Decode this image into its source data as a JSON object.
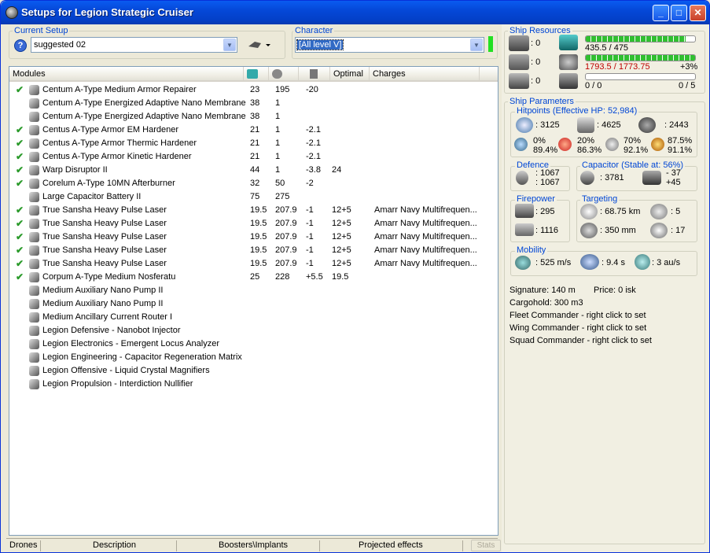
{
  "window": {
    "title": "Setups for Legion Strategic Cruiser"
  },
  "current_setup": {
    "label": "Current Setup",
    "value": "suggested 02"
  },
  "character": {
    "label": "Character",
    "value": "[All level V]"
  },
  "modules": {
    "headers": [
      "Modules",
      "",
      "",
      "",
      "Optimal",
      "Charges"
    ],
    "rows": [
      {
        "check": "✔",
        "name": "Centum A-Type Medium Armor Repairer",
        "c1": "23",
        "c2": "195",
        "c3": "-20",
        "c4": "",
        "c5": ""
      },
      {
        "check": "",
        "name": "Centum A-Type Energized Adaptive Nano Membrane",
        "c1": "38",
        "c2": "1",
        "c3": "",
        "c4": "",
        "c5": ""
      },
      {
        "check": "",
        "name": "Centum A-Type Energized Adaptive Nano Membrane",
        "c1": "38",
        "c2": "1",
        "c3": "",
        "c4": "",
        "c5": ""
      },
      {
        "check": "✔",
        "name": "Centus A-Type Armor EM Hardener",
        "c1": "21",
        "c2": "1",
        "c3": "-2.1",
        "c4": "",
        "c5": ""
      },
      {
        "check": "✔",
        "name": "Centus A-Type Armor Thermic Hardener",
        "c1": "21",
        "c2": "1",
        "c3": "-2.1",
        "c4": "",
        "c5": ""
      },
      {
        "check": "✔",
        "name": "Centus A-Type Armor Kinetic Hardener",
        "c1": "21",
        "c2": "1",
        "c3": "-2.1",
        "c4": "",
        "c5": ""
      },
      {
        "check": "✔",
        "name": "Warp Disruptor II",
        "c1": "44",
        "c2": "1",
        "c3": "-3.8",
        "c4": "24",
        "c5": ""
      },
      {
        "check": "✔",
        "name": "Corelum A-Type 10MN Afterburner",
        "c1": "32",
        "c2": "50",
        "c3": "-2",
        "c4": "",
        "c5": ""
      },
      {
        "check": "",
        "name": "Large Capacitor Battery II",
        "c1": "75",
        "c2": "275",
        "c3": "",
        "c4": "",
        "c5": ""
      },
      {
        "check": "✔",
        "name": "True Sansha Heavy Pulse Laser",
        "c1": "19.5",
        "c2": "207.9",
        "c3": "-1",
        "c4": "12+5",
        "c5": "Amarr Navy Multifrequen..."
      },
      {
        "check": "✔",
        "name": "True Sansha Heavy Pulse Laser",
        "c1": "19.5",
        "c2": "207.9",
        "c3": "-1",
        "c4": "12+5",
        "c5": "Amarr Navy Multifrequen..."
      },
      {
        "check": "✔",
        "name": "True Sansha Heavy Pulse Laser",
        "c1": "19.5",
        "c2": "207.9",
        "c3": "-1",
        "c4": "12+5",
        "c5": "Amarr Navy Multifrequen..."
      },
      {
        "check": "✔",
        "name": "True Sansha Heavy Pulse Laser",
        "c1": "19.5",
        "c2": "207.9",
        "c3": "-1",
        "c4": "12+5",
        "c5": "Amarr Navy Multifrequen..."
      },
      {
        "check": "✔",
        "name": "True Sansha Heavy Pulse Laser",
        "c1": "19.5",
        "c2": "207.9",
        "c3": "-1",
        "c4": "12+5",
        "c5": "Amarr Navy Multifrequen..."
      },
      {
        "check": "✔",
        "name": "Corpum A-Type Medium Nosferatu",
        "c1": "25",
        "c2": "228",
        "c3": "+5.5",
        "c4": "19.5",
        "c5": ""
      },
      {
        "check": "",
        "name": "Medium Auxiliary Nano Pump II",
        "c1": "",
        "c2": "",
        "c3": "",
        "c4": "",
        "c5": ""
      },
      {
        "check": "",
        "name": "Medium Auxiliary Nano Pump II",
        "c1": "",
        "c2": "",
        "c3": "",
        "c4": "",
        "c5": ""
      },
      {
        "check": "",
        "name": "Medium Ancillary Current Router I",
        "c1": "",
        "c2": "",
        "c3": "",
        "c4": "",
        "c5": ""
      },
      {
        "check": "",
        "name": "Legion Defensive - Nanobot Injector",
        "c1": "",
        "c2": "",
        "c3": "",
        "c4": "",
        "c5": ""
      },
      {
        "check": "",
        "name": "Legion Electronics - Emergent Locus Analyzer",
        "c1": "",
        "c2": "",
        "c3": "",
        "c4": "",
        "c5": ""
      },
      {
        "check": "",
        "name": "Legion Engineering - Capacitor Regeneration Matrix",
        "c1": "",
        "c2": "",
        "c3": "",
        "c4": "",
        "c5": ""
      },
      {
        "check": "",
        "name": "Legion Offensive - Liquid Crystal Magnifiers",
        "c1": "",
        "c2": "",
        "c3": "",
        "c4": "",
        "c5": ""
      },
      {
        "check": "",
        "name": "Legion Propulsion - Interdiction Nullifier",
        "c1": "",
        "c2": "",
        "c3": "",
        "c4": "",
        "c5": ""
      }
    ]
  },
  "bottom_tabs": {
    "drones": "Drones",
    "description": "Description",
    "boosters": "Boosters\\Implants",
    "projected": "Projected effects",
    "stats": "Stats"
  },
  "resources": {
    "label": "Ship Resources",
    "turret": ": 0",
    "launcher": ": 0",
    "drone_bay": ": 0",
    "cpu_text": "435.5 / 475",
    "cpu_fill": 0.917,
    "pg_text": "1793.5 / 1773.75",
    "pg_pct": "+3%",
    "pg_fill": 1.0,
    "calib_left": "0 / 0",
    "calib_right": "0 / 5",
    "calib_fill": 0
  },
  "params": {
    "label": "Ship Parameters",
    "hp_label": "Hitpoints (Effective HP: 52,984)",
    "shield": ": 3125",
    "armor": ": 4625",
    "structure": ": 2443",
    "r1a": "0%",
    "r1b": "89.4%",
    "r2a": "20%",
    "r2b": "86.3%",
    "r3a": "70%",
    "r3b": "92.1%",
    "r4a": "87.5%",
    "r4b": "91.1%",
    "defence_label": "Defence",
    "def1": ": 1067",
    "def2": ": 1067",
    "cap_label": "Capacitor (Stable at: 56%)",
    "cap_val": ": 3781",
    "cap_a": "- 37",
    "cap_b": "+45",
    "fire_label": "Firepower",
    "fire1": ": 295",
    "fire2": ": 1116",
    "targ_label": "Targeting",
    "t1": ": 68.75 km",
    "t2": ": 5",
    "t3": ": 350 mm",
    "t4": ": 17",
    "mob_label": "Mobility",
    "m1": ": 525 m/s",
    "m2": ": 9.4 s",
    "m3": ": 3 au/s",
    "signature": "Signature: 140 m",
    "price": "Price: 0 isk",
    "cargo": "Cargohold: 300 m3",
    "fleet": "Fleet Commander - right click to set",
    "wing": "Wing Commander - right click to set",
    "squad": "Squad Commander - right click to set"
  }
}
